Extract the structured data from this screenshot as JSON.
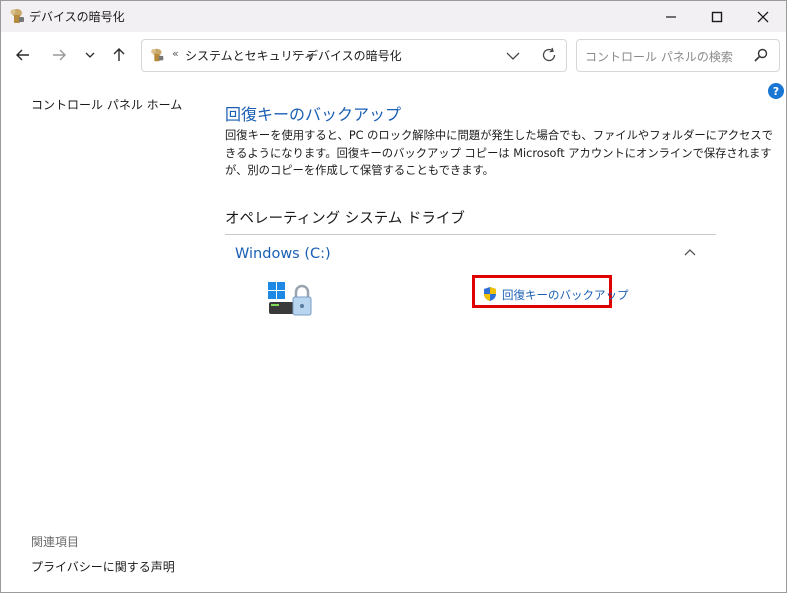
{
  "window": {
    "title": "デバイスの暗号化"
  },
  "address": {
    "overflow": "«",
    "segments": [
      "システムとセキュリティ",
      "デバイスの暗号化"
    ],
    "separator": "›"
  },
  "search": {
    "placeholder": "コントロール パネルの検索"
  },
  "sidebar": {
    "home_link": "コントロール パネル ホーム",
    "related_title": "関連項目",
    "privacy_link": "プライバシーに関する声明"
  },
  "main": {
    "title": "回復キーのバックアップ",
    "description": "回復キーを使用すると、PC のロック解除中に問題が発生した場合でも、ファイルやフォルダーにアクセスできるようになります。回復キーのバックアップ コピーは Microsoft アカウントにオンラインで保存されますが、別のコピーを作成して保管することもできます。",
    "section_title": "オペレーティング システム ドライブ",
    "drive_name": "Windows (C:)",
    "backup_link": "回復キーのバックアップ"
  },
  "icons": {
    "help": "?",
    "colors": {
      "link": "#1a5fb4",
      "highlight": "#e00000",
      "help": "#1976d2"
    }
  }
}
